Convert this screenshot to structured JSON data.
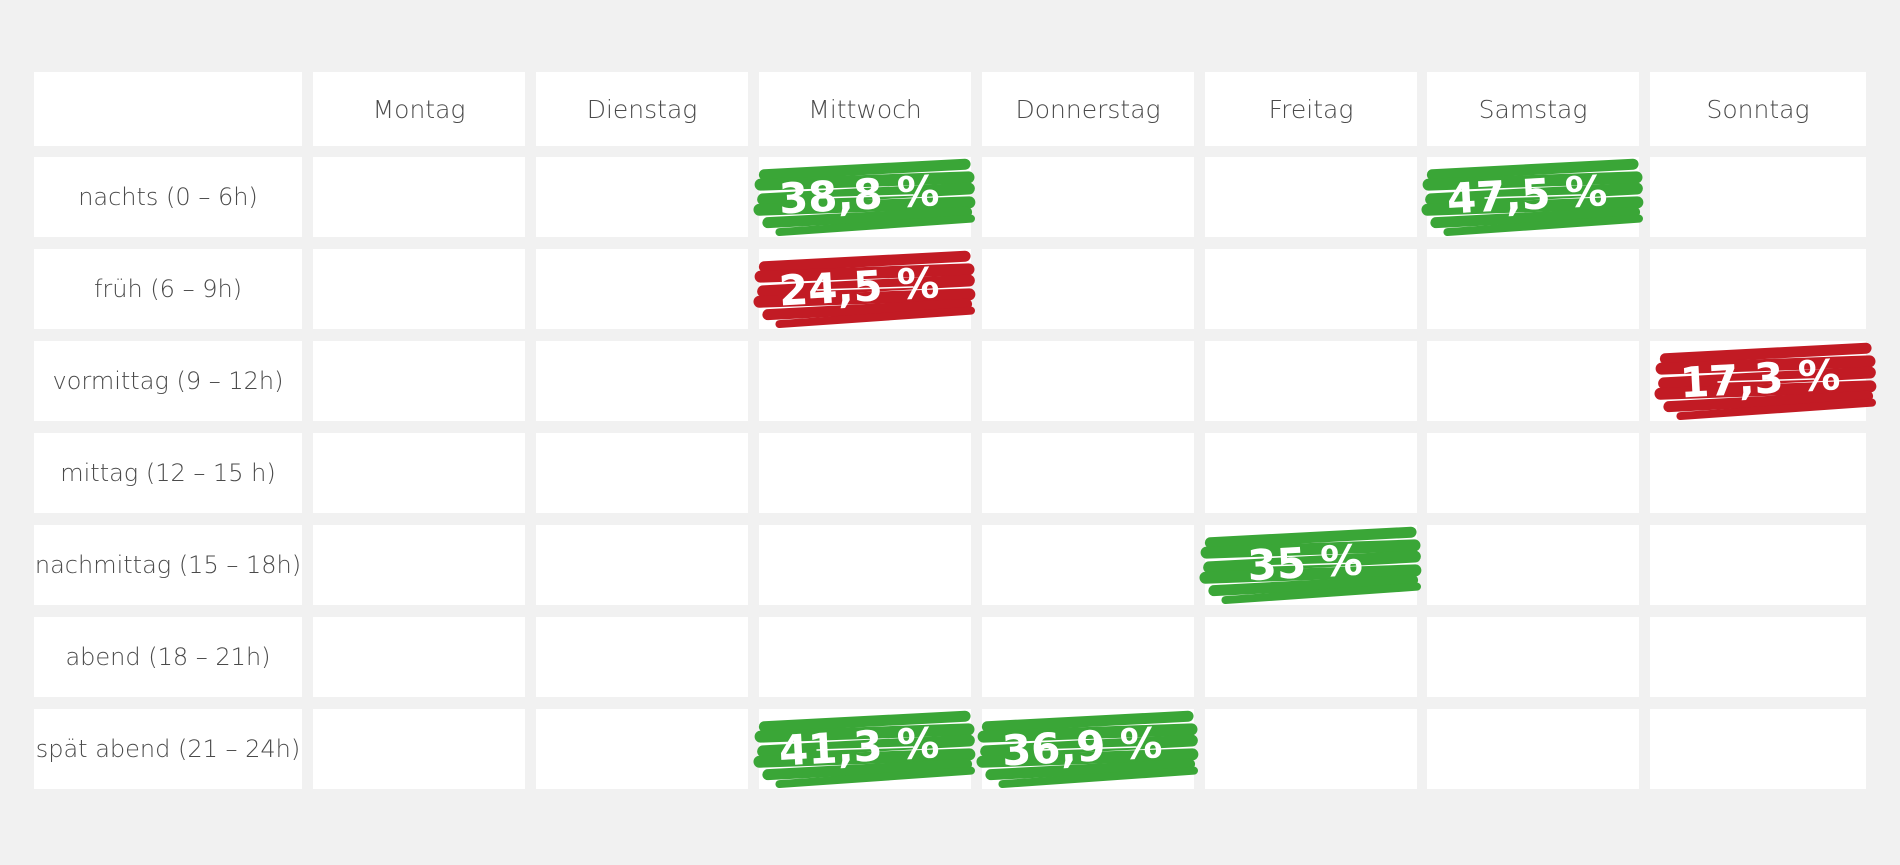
{
  "chart_data": {
    "type": "table",
    "columns": [
      "Montag",
      "Dienstag",
      "Mittwoch",
      "Donnerstag",
      "Freitag",
      "Samstag",
      "Sonntag"
    ],
    "rows": [
      "nachts (0 – 6h)",
      "früh (6 – 9h)",
      "vormittag (9 – 12h)",
      "mittag (12 – 15 h)",
      "nachmittag (15 – 18h)",
      "abend (18 – 21h)",
      "spät abend (21 – 24h)"
    ],
    "highlights": [
      {
        "row": 0,
        "col": 2,
        "label": "38,8 %",
        "value": 38.8,
        "kind": "positive"
      },
      {
        "row": 0,
        "col": 5,
        "label": "47,5 %",
        "value": 47.5,
        "kind": "positive"
      },
      {
        "row": 1,
        "col": 2,
        "label": "24,5 %",
        "value": 24.5,
        "kind": "negative"
      },
      {
        "row": 2,
        "col": 6,
        "label": "17,3 %",
        "value": 17.3,
        "kind": "negative"
      },
      {
        "row": 4,
        "col": 4,
        "label": "35 %",
        "value": 35,
        "kind": "positive"
      },
      {
        "row": 6,
        "col": 2,
        "label": "41,3 %",
        "value": 41.3,
        "kind": "positive"
      },
      {
        "row": 6,
        "col": 3,
        "label": "36,9 %",
        "value": 36.9,
        "kind": "positive"
      }
    ],
    "colors": {
      "positive": "#3aa637",
      "negative": "#c21b24",
      "background": "#f1f1f1",
      "cell": "#ffffff",
      "text": "#4a4a4a"
    }
  }
}
